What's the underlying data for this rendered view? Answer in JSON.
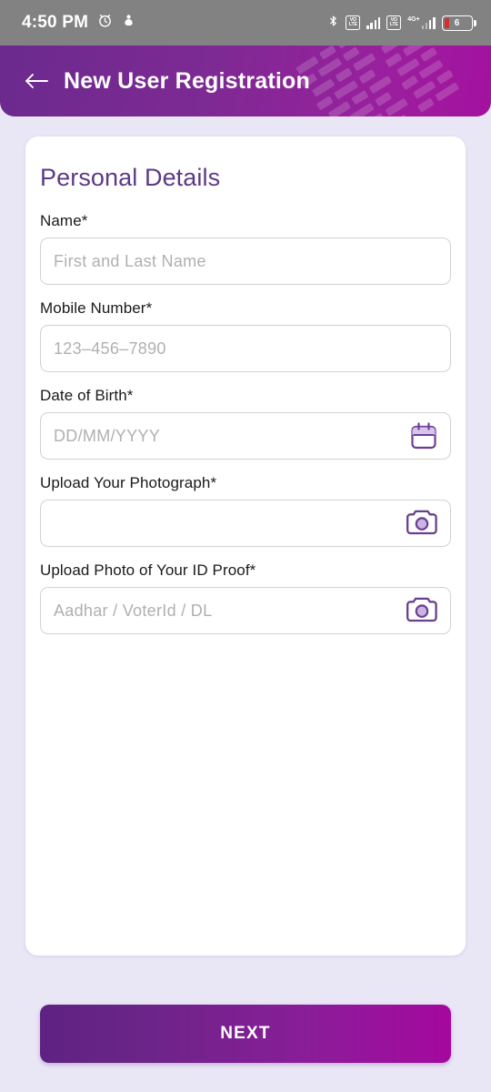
{
  "status_bar": {
    "time": "4:50 PM",
    "alarm_icon": "alarm-clock-icon",
    "profile_icon": "person-icon",
    "bluetooth_icon": "bluetooth-icon",
    "sim1_volte_label": "VO",
    "sim1_volte_label2": "LTE",
    "sim2_volte_label": "VO",
    "sim2_volte_label2": "LTE",
    "network_type": "4G+",
    "battery_percent": "6"
  },
  "header": {
    "back_icon": "back-arrow-icon",
    "title": "New User Registration",
    "watermark": "tire-track-pattern",
    "gradient_start": "#6b2a8e",
    "gradient_end": "#a4119f"
  },
  "form": {
    "section_title": "Personal Details",
    "title_color": "#5c3a86",
    "fields": [
      {
        "label": "Name*",
        "placeholder": "First and Last Name",
        "value": "",
        "icon": null
      },
      {
        "label": "Mobile Number*",
        "placeholder": "123–456–7890",
        "value": "",
        "icon": null
      },
      {
        "label": "Date of Birth*",
        "placeholder": "DD/MM/YYYY",
        "value": "",
        "icon": "calendar-icon"
      },
      {
        "label": "Upload Your Photograph*",
        "placeholder": "",
        "value": "",
        "icon": "camera-icon"
      },
      {
        "label": "Upload Photo of Your ID Proof*",
        "placeholder": "Aadhar / VoterId / DL",
        "value": "",
        "icon": "camera-icon"
      }
    ]
  },
  "footer": {
    "next_label": "NEXT",
    "next_gradient_start": "#5d2382",
    "next_gradient_end": "#a5089f"
  },
  "theme": {
    "page_background": "#e9e6f6",
    "card_background": "#ffffff",
    "accent_purple": "#6b3f8f",
    "icon_fill_light": "#c9b4e4",
    "status_bar_background": "#828282"
  }
}
